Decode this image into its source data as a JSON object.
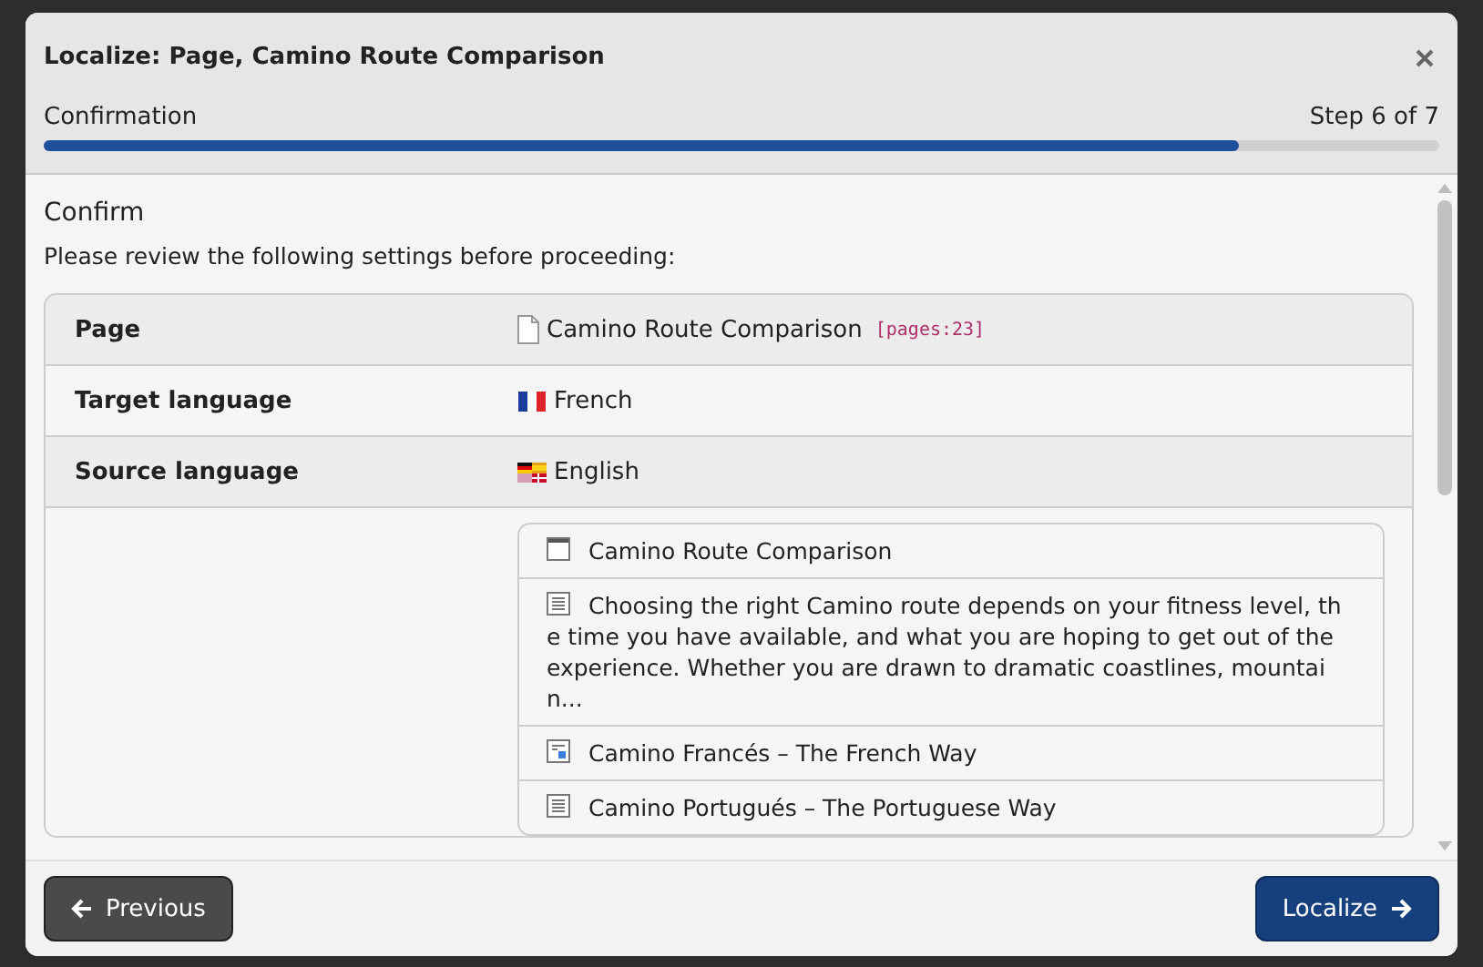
{
  "dialog": {
    "title": "Localize: Page, Camino Route Comparison",
    "progress": {
      "label": "Confirmation",
      "step": "Step 6 of 7",
      "level": 0.856
    }
  },
  "section": {
    "heading": "Confirm",
    "intro": "Please review the following settings before proceeding:"
  },
  "settings": [
    {
      "kind": "page",
      "label": "Page",
      "value": "Camino Route Comparison",
      "tag": "[pages:23]"
    },
    {
      "kind": "french",
      "label": "Target language",
      "value": "French"
    },
    {
      "kind": "multi",
      "label": "Source language",
      "value": "English"
    }
  ],
  "preview": [
    {
      "kind": "title",
      "text": "Camino Route Comparison"
    },
    {
      "kind": "text",
      "text": "Choosing the right Camino route depends on your fitness level, the time you have available, and what you are hoping to get out of the experience. Whether you are drawn to dramatic coastlines, mountain..."
    },
    {
      "kind": "page",
      "text": "Camino Francés – The French Way"
    },
    {
      "kind": "text",
      "text": "Camino Portugués – The Portuguese Way"
    }
  ],
  "buttons": {
    "previous": "Previous",
    "next": "Localize"
  }
}
